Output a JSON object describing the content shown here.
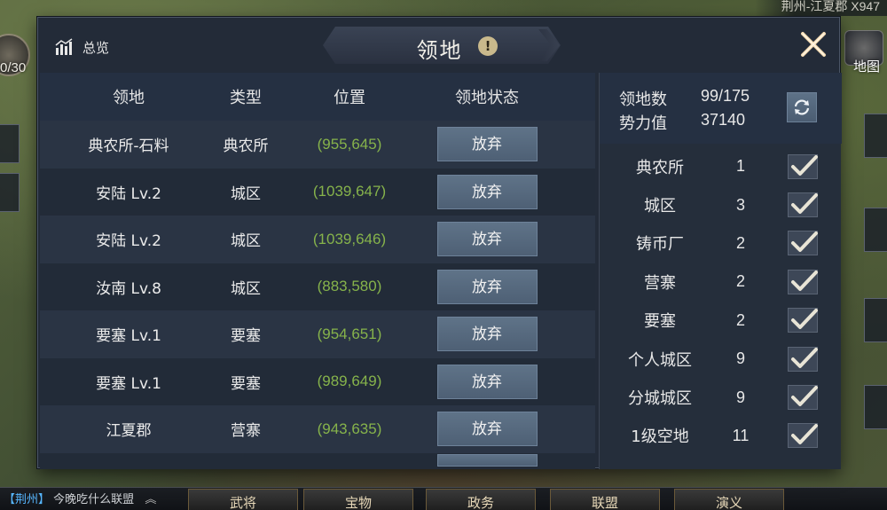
{
  "map": {
    "top_right_label": "荆州-江夏郡  X947",
    "left_count": "0/30",
    "right_map_label": "地图"
  },
  "bottom": {
    "chat_tag": "【荆州】",
    "chat_text": "今晚吃什么联盟",
    "buttons": [
      "武将",
      "宝物",
      "政务",
      "联盟",
      "演义"
    ]
  },
  "dialog": {
    "title": "领地",
    "overview_label": "总览",
    "info_glyph": "!"
  },
  "table": {
    "headers": [
      "领地",
      "类型",
      "位置",
      "领地状态"
    ],
    "rows": [
      {
        "name": "典农所-石料",
        "type": "典农所",
        "pos": "(955,645)",
        "action": "放弃"
      },
      {
        "name": "安陆 Lv.2",
        "type": "城区",
        "pos": "(1039,647)",
        "action": "放弃"
      },
      {
        "name": "安陆 Lv.2",
        "type": "城区",
        "pos": "(1039,646)",
        "action": "放弃"
      },
      {
        "name": "汝南 Lv.8",
        "type": "城区",
        "pos": "(883,580)",
        "action": "放弃"
      },
      {
        "name": "要塞 Lv.1",
        "type": "要塞",
        "pos": "(954,651)",
        "action": "放弃"
      },
      {
        "name": "要塞 Lv.1",
        "type": "要塞",
        "pos": "(989,649)",
        "action": "放弃"
      },
      {
        "name": "江夏郡",
        "type": "营寨",
        "pos": "(943,635)",
        "action": "放弃"
      }
    ]
  },
  "stats": {
    "territory_label": "领地数",
    "territory_value": "99/175",
    "power_label": "势力值",
    "power_value": "37140"
  },
  "filters": [
    {
      "name": "典农所",
      "count": "1",
      "checked": true
    },
    {
      "name": "城区",
      "count": "3",
      "checked": true
    },
    {
      "name": "铸币厂",
      "count": "2",
      "checked": true
    },
    {
      "name": "营寨",
      "count": "2",
      "checked": true
    },
    {
      "name": "要塞",
      "count": "2",
      "checked": true
    },
    {
      "name": "个人城区",
      "count": "9",
      "checked": true
    },
    {
      "name": "分城城区",
      "count": "9",
      "checked": true
    },
    {
      "name": "1级空地",
      "count": "11",
      "checked": true
    }
  ],
  "colors": {
    "dialog_bg": "#232b38",
    "position_text": "#86b34b",
    "button_bg": "#56697e",
    "check_color": "#e8e4d6"
  }
}
